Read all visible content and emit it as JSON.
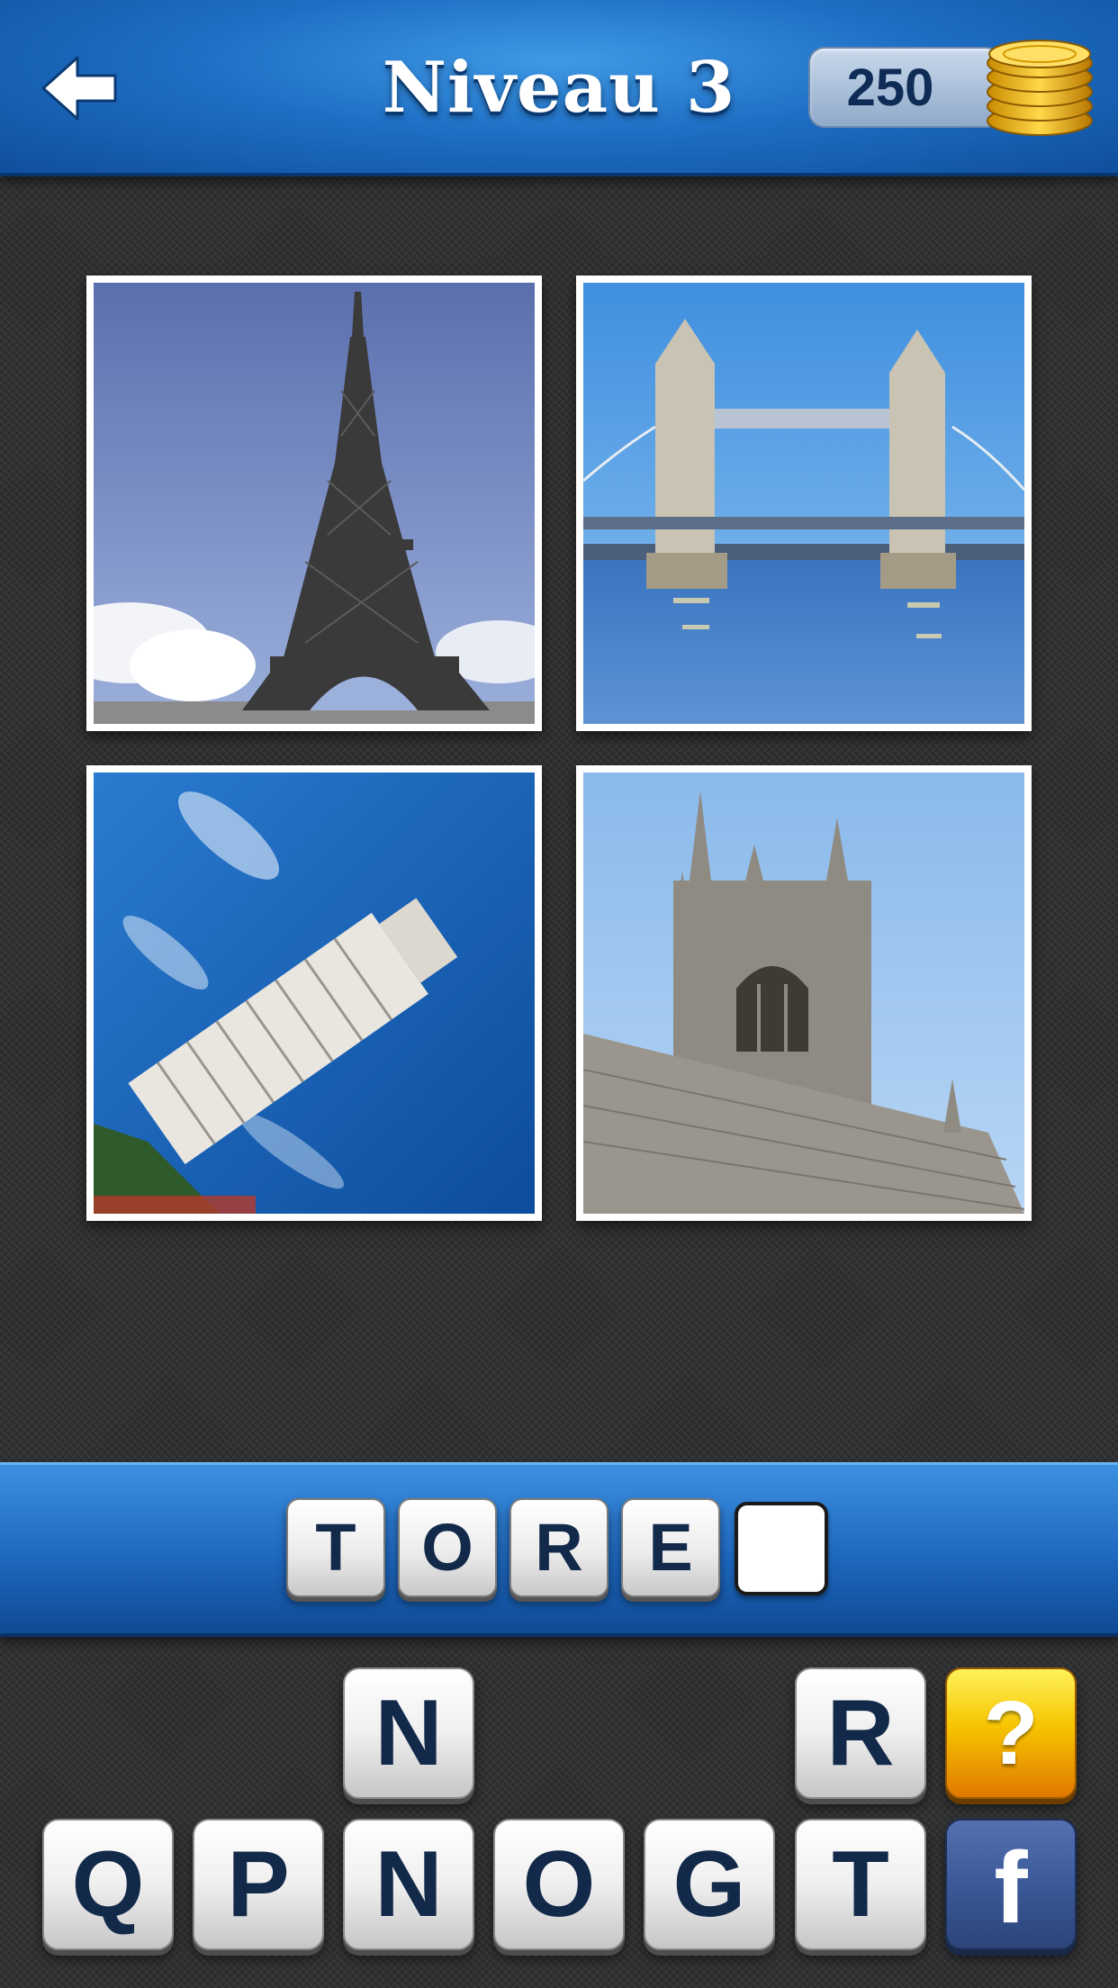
{
  "header": {
    "title": "Niveau 3",
    "coins": "250",
    "back_icon": "arrow-left-icon",
    "coins_icon": "gold-coin-stack-icon"
  },
  "photos": [
    {
      "subject": "eiffel-tower"
    },
    {
      "subject": "tower-bridge"
    },
    {
      "subject": "leaning-tower-of-pisa"
    },
    {
      "subject": "gothic-church-tower"
    }
  ],
  "answer": {
    "letters": [
      "T",
      "O",
      "R",
      "E",
      ""
    ]
  },
  "keyboard": {
    "row1": [
      "N",
      "R"
    ],
    "row2": [
      "Q",
      "P",
      "N",
      "O",
      "G",
      "T"
    ],
    "hint_label": "?",
    "facebook_label": "f"
  },
  "colors": {
    "header_blue": "#1f6fc6",
    "hint_yellow": "#f6c400",
    "facebook_blue": "#3b5998",
    "letter_navy": "#13294a"
  }
}
